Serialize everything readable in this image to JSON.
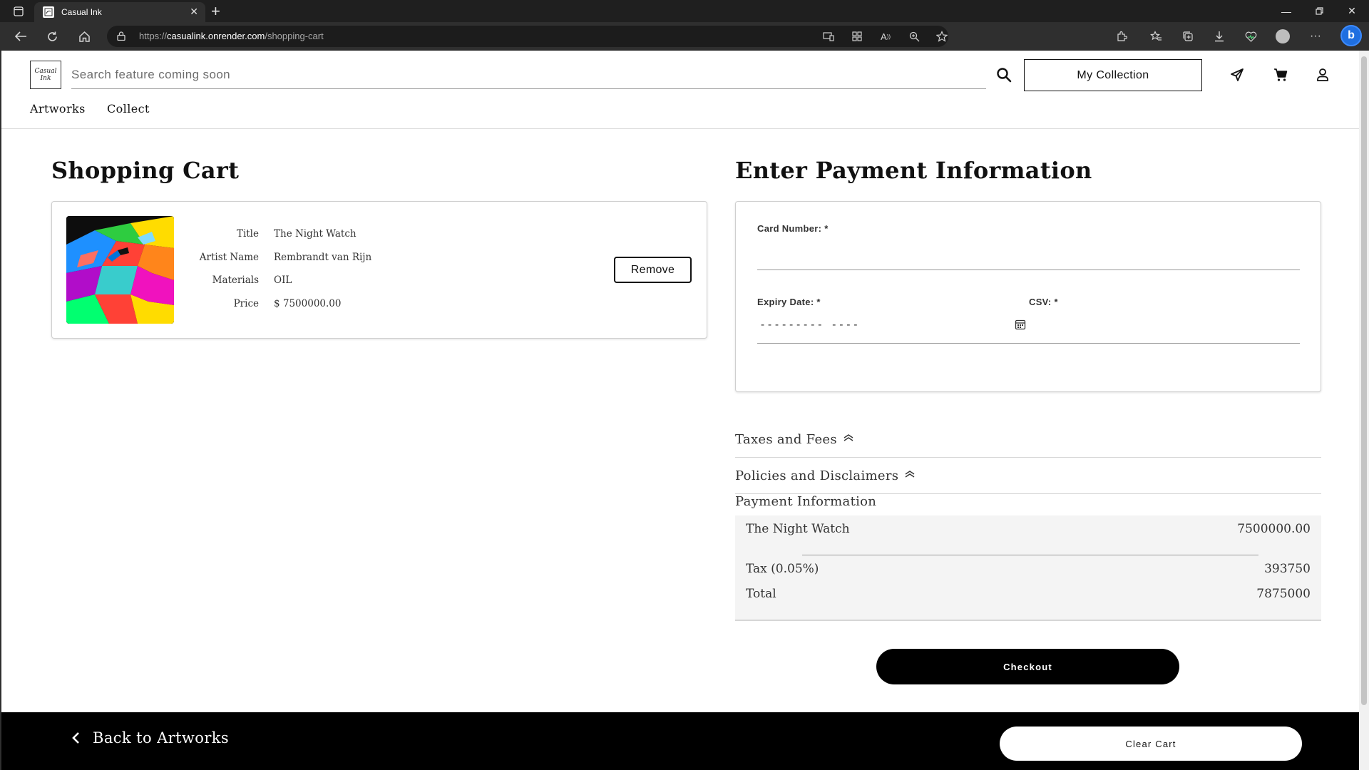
{
  "browser": {
    "tab_title": "Casual Ink",
    "url_scheme": "https://",
    "url_host": "casualink.onrender.com",
    "url_path": "/shopping-cart",
    "accent": "#1f6fe0"
  },
  "header": {
    "logo_text": "Casual Ink",
    "search_placeholder": "Search feature coming soon",
    "collection_label": "My Collection",
    "nav": [
      "Artworks",
      "Collect"
    ]
  },
  "cart": {
    "heading": "Shopping Cart",
    "item": {
      "labels": {
        "title": "Title",
        "artist": "Artist Name",
        "materials": "Materials",
        "price": "Price"
      },
      "title": "The Night Watch",
      "artist": "Rembrandt van Rijn",
      "materials": "OIL",
      "price": "$ 7500000.00",
      "remove_label": "Remove"
    }
  },
  "payment": {
    "heading": "Enter Payment Information",
    "card_number_label": "Card Number: *",
    "expiry_label": "Expiry Date: *",
    "expiry_placeholder": "---------  ----",
    "csv_label": "CSV: *"
  },
  "accordions": {
    "taxes": "Taxes and Fees",
    "policies": "Policies and Disclaimers",
    "payment_info": "Payment Information"
  },
  "summary": {
    "item_name": "The Night Watch",
    "item_amount": "7500000.00",
    "tax_label": "Tax (0.05%)",
    "tax_amount": "393750",
    "total_label": "Total",
    "total_amount": "7875000"
  },
  "actions": {
    "checkout": "Checkout",
    "back": "Back to Artworks",
    "clear": "Clear Cart"
  }
}
